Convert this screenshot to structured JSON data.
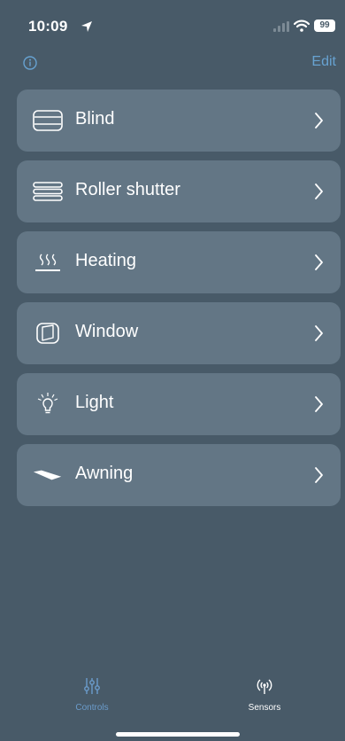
{
  "status_bar": {
    "time": "10:09",
    "battery": "99"
  },
  "header": {
    "edit_label": "Edit"
  },
  "controls": [
    {
      "label": "Blind",
      "icon": "blind-icon"
    },
    {
      "label": "Roller shutter",
      "icon": "roller-shutter-icon"
    },
    {
      "label": "Heating",
      "icon": "heating-icon"
    },
    {
      "label": "Window",
      "icon": "window-icon"
    },
    {
      "label": "Light",
      "icon": "light-bulb-icon"
    },
    {
      "label": "Awning",
      "icon": "awning-icon"
    }
  ],
  "tabs": [
    {
      "label": "Controls",
      "icon": "sliders-icon",
      "active": true
    },
    {
      "label": "Sensors",
      "icon": "antenna-icon",
      "active": false
    }
  ],
  "colors": {
    "background": "#485a68",
    "card": "#637685",
    "accent": "#67a2d1"
  }
}
